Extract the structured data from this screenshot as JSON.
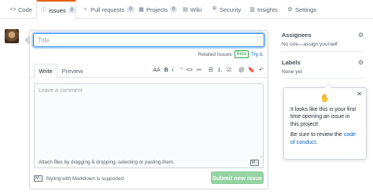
{
  "nav": {
    "tabs": [
      {
        "icon": "code-icon",
        "glyph": "<>",
        "label": "Code",
        "count": null
      },
      {
        "icon": "issue-icon",
        "glyph": "ⓘ",
        "label": "Issues",
        "count": "0"
      },
      {
        "icon": "pull-request-icon",
        "glyph": "⑂",
        "label": "Pull requests",
        "count": "0"
      },
      {
        "icon": "projects-icon",
        "glyph": "▦",
        "label": "Projects",
        "count": "0"
      },
      {
        "icon": "wiki-icon",
        "glyph": "▤",
        "label": "Wiki",
        "count": null
      },
      {
        "icon": "shield-icon",
        "glyph": "⛨",
        "label": "Security",
        "count": null
      },
      {
        "icon": "graph-icon",
        "glyph": "▥",
        "label": "Insights",
        "count": null
      },
      {
        "icon": "gear-icon",
        "glyph": "⚙",
        "label": "Settings",
        "count": null
      }
    ],
    "selected": "Issues",
    "accent_color": "#e36209"
  },
  "form": {
    "title_placeholder": "Title",
    "related_issues_label": "Related Issues",
    "beta_badge": "Beta",
    "try_it": "Try it.",
    "tabs": {
      "write": "Write",
      "preview": "Preview"
    },
    "toolbar": [
      "AA",
      "B",
      "i",
      "”",
      "<>",
      "⚯",
      "☰",
      "⒈",
      "☑",
      "@",
      "🔖",
      "↶"
    ],
    "comment_placeholder": "Leave a comment",
    "attach_text": "Attach files by dragging & dropping, selecting or pasting them.",
    "markdown_badge": "M↓",
    "styling_text": "Styling with Markdown is supported",
    "submit_label": "Submit new issue",
    "submit_color": "#94d3a2"
  },
  "sidebar": {
    "assignees": {
      "heading": "Assignees",
      "value": "No one—assign yourself"
    },
    "labels": {
      "heading": "Labels",
      "value": "None yet"
    }
  },
  "popover": {
    "wave_icon": "wave-icon",
    "text1": "It looks like this is your first time opening an issue in this project!",
    "text2_prefix": "Be sure to review the ",
    "text2_link": "code of conduct",
    "text2_suffix": "."
  }
}
